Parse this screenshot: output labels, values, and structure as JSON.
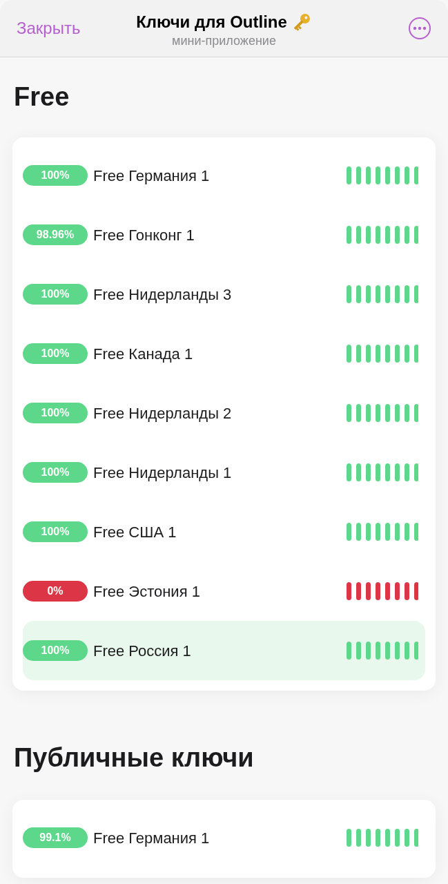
{
  "header": {
    "close": "Закрыть",
    "title": "Ключи для Outline",
    "subtitle": "мини-приложение"
  },
  "sections": [
    {
      "title": "Free",
      "servers": [
        {
          "uptime": "100%",
          "name": "Free Германия 1",
          "color": "#5dd88a",
          "selected": false
        },
        {
          "uptime": "98.96%",
          "name": "Free Гонконг 1",
          "color": "#5dd88a",
          "selected": false
        },
        {
          "uptime": "100%",
          "name": "Free Нидерланды 3",
          "color": "#5dd88a",
          "selected": false
        },
        {
          "uptime": "100%",
          "name": "Free Канада 1",
          "color": "#5dd88a",
          "selected": false
        },
        {
          "uptime": "100%",
          "name": "Free Нидерланды 2",
          "color": "#5dd88a",
          "selected": false
        },
        {
          "uptime": "100%",
          "name": "Free Нидерланды 1",
          "color": "#5dd88a",
          "selected": false
        },
        {
          "uptime": "100%",
          "name": "Free США 1",
          "color": "#5dd88a",
          "selected": false
        },
        {
          "uptime": "0%",
          "name": "Free Эстония 1",
          "color": "#dc3545",
          "selected": false
        },
        {
          "uptime": "100%",
          "name": "Free Россия 1",
          "color": "#5dd88a",
          "selected": true
        }
      ]
    },
    {
      "title": "Публичные ключи",
      "servers": [
        {
          "uptime": "99.1%",
          "name": "Free Германия 1",
          "color": "#5dd88a",
          "selected": false
        }
      ]
    }
  ]
}
